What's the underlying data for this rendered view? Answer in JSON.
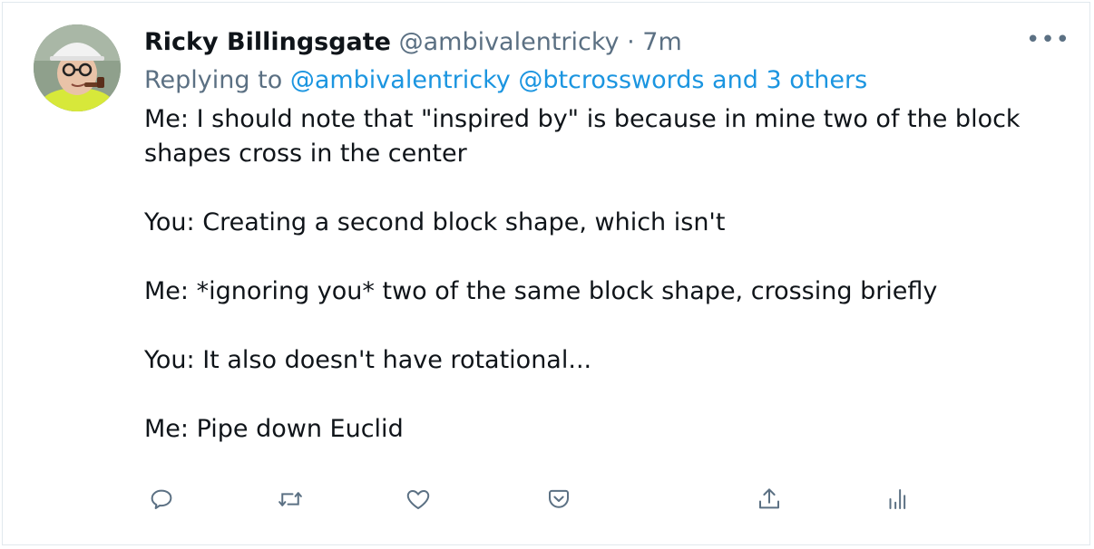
{
  "tweet": {
    "author_name": "Ricky Billingsgate",
    "author_handle": "@ambivalentricky",
    "separator": "·",
    "time": "7m",
    "more_label": "•••",
    "replying_prefix": "Replying to",
    "replying_users": "@ambivalentricky @btcrosswords and 3 others",
    "paragraphs": [
      "Me: I should note that \"inspired by\" is because in mine two of the block shapes cross in the center",
      "You: Creating a second block shape, which isn't",
      "Me: *ignoring you* two of the same block shape, crossing briefly",
      "You: It also doesn't have rotational...",
      "Me: Pipe down Euclid"
    ]
  },
  "actions": [
    {
      "name": "reply",
      "icon": "reply-icon"
    },
    {
      "name": "retweet",
      "icon": "retweet-icon"
    },
    {
      "name": "like",
      "icon": "heart-icon"
    },
    {
      "name": "bookmark",
      "icon": "pocket-icon"
    },
    {
      "name": "share",
      "icon": "share-icon"
    },
    {
      "name": "analytics",
      "icon": "analytics-icon"
    }
  ],
  "colors": {
    "text": "#0f1419",
    "secondary": "#5b7083",
    "link": "#1b95e0",
    "border": "#e1e8ed"
  }
}
